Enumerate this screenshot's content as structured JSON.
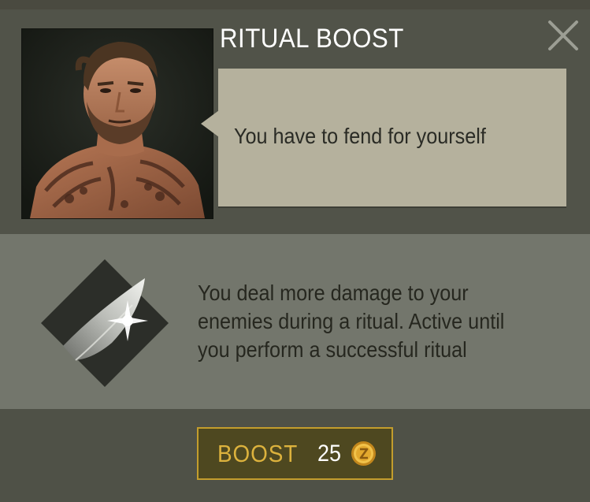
{
  "dialog": {
    "title": "RITUAL BOOST",
    "close_icon": "close-icon",
    "accent_color": "#c39d2c"
  },
  "character": {
    "portrait_icon": "bearded-tattooed-man-portrait",
    "speech": "You have to fend for yourself"
  },
  "boost": {
    "icon": "blade-diamond-icon",
    "description_lines": [
      "You deal more damage to your",
      "enemies during a ritual. Active until",
      "you perform a successful ritual"
    ]
  },
  "action": {
    "label": "BOOST",
    "cost": "25",
    "currency_icon": "gold-coin-icon"
  }
}
